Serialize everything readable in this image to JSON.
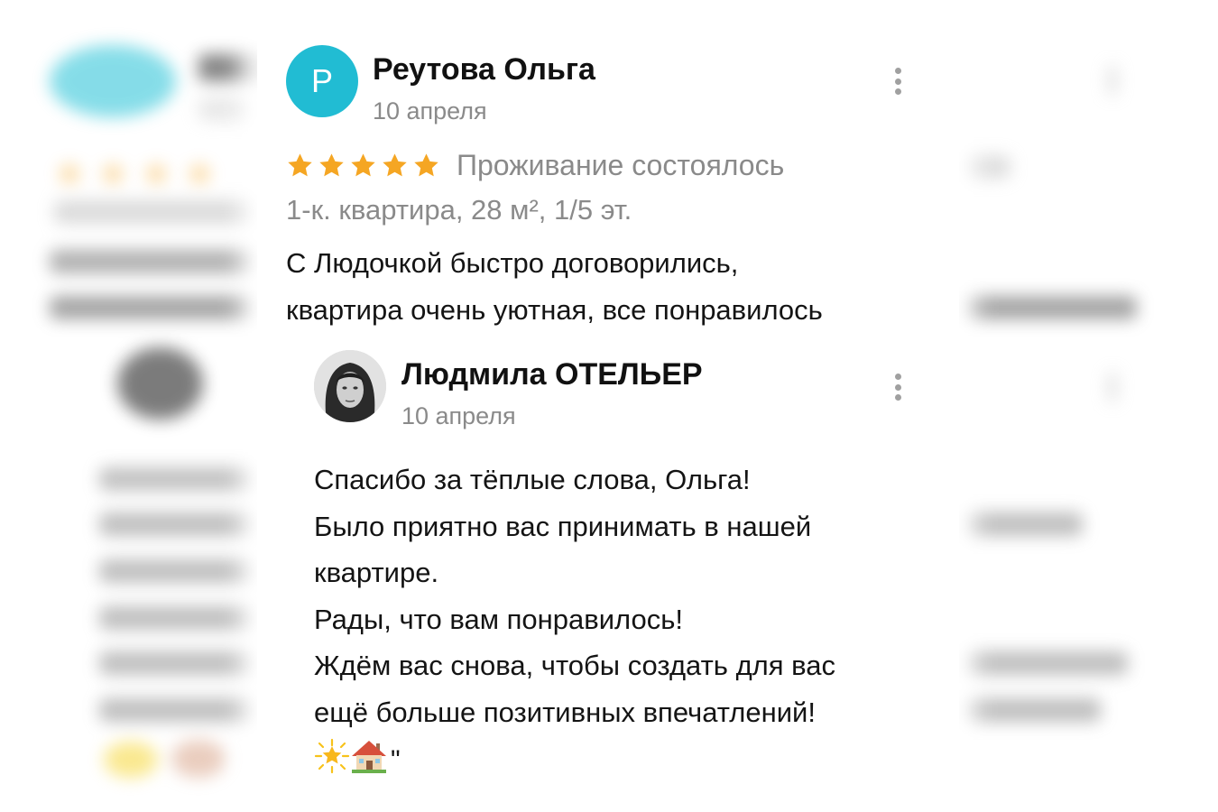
{
  "review": {
    "avatar_letter": "Р",
    "author": "Реутова Ольга",
    "date": "10 апреля",
    "rating": 5,
    "stay_status": "Проживание состоялось",
    "apartment": "1-к. квартира, 28 м², 1/5 эт.",
    "text_lines": [
      "С Людочкой быстро договорились,",
      "квартира очень уютная, все понравилось"
    ]
  },
  "reply": {
    "author": "Людмила ОТЕЛЬЕР",
    "date": "10 апреля",
    "text_lines": [
      "Спасибо за тёплые слова, Ольга!",
      "Было приятно вас принимать в нашей",
      "квартире.",
      "Рады, что вам понравилось!",
      "Ждём вас снова, чтобы создать для вас",
      "ещё больше позитивных впечатлений!"
    ],
    "emoji": [
      "glowing-star",
      "house-with-garden"
    ],
    "trailing_mark": "\""
  },
  "icons": {
    "menu": "more-vertical-icon",
    "star": "star-icon"
  },
  "colors": {
    "avatar": "#21bcd3",
    "star": "#f5a623",
    "muted_text": "#8a8a8a",
    "text": "#141414"
  }
}
